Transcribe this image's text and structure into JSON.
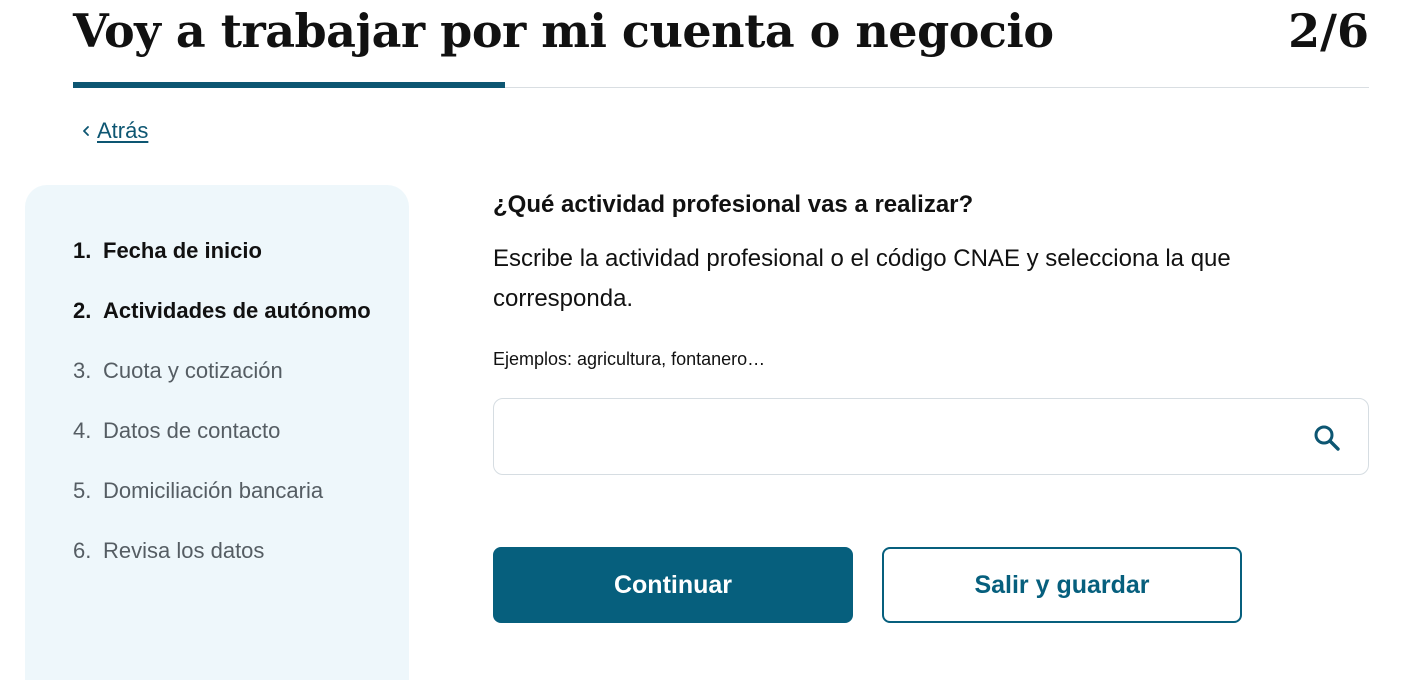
{
  "header": {
    "title": "Voy a trabajar por mi cuenta o negocio",
    "step_counter": "2/6",
    "progress_fraction": 0.3333
  },
  "nav": {
    "back_label": "Atrás",
    "back_icon": "chevron-left-icon"
  },
  "sidebar": {
    "steps": [
      {
        "number": "1.",
        "label": "Fecha de inicio",
        "state": "completed"
      },
      {
        "number": "2.",
        "label": "Actividades de autónomo",
        "state": "current"
      },
      {
        "number": "3.",
        "label": "Cuota y cotización",
        "state": "pending"
      },
      {
        "number": "4.",
        "label": "Datos de contacto",
        "state": "pending"
      },
      {
        "number": "5.",
        "label": "Domiciliación bancaria",
        "state": "pending"
      },
      {
        "number": "6.",
        "label": "Revisa los datos",
        "state": "pending"
      }
    ]
  },
  "form": {
    "question": "¿Qué actividad profesional vas a realizar?",
    "instructions": "Escribe la actividad profesional o el código CNAE y selecciona la que corresponda.",
    "hint": "Ejemplos: agricultura, fontanero…",
    "search": {
      "value": "",
      "placeholder": "",
      "icon": "search-icon"
    }
  },
  "actions": {
    "continue_label": "Continuar",
    "save_exit_label": "Salir y guardar"
  },
  "colors": {
    "primary": "#065f7d",
    "sidebar_bg": "#eef7fb",
    "progress": "#0d5672"
  }
}
